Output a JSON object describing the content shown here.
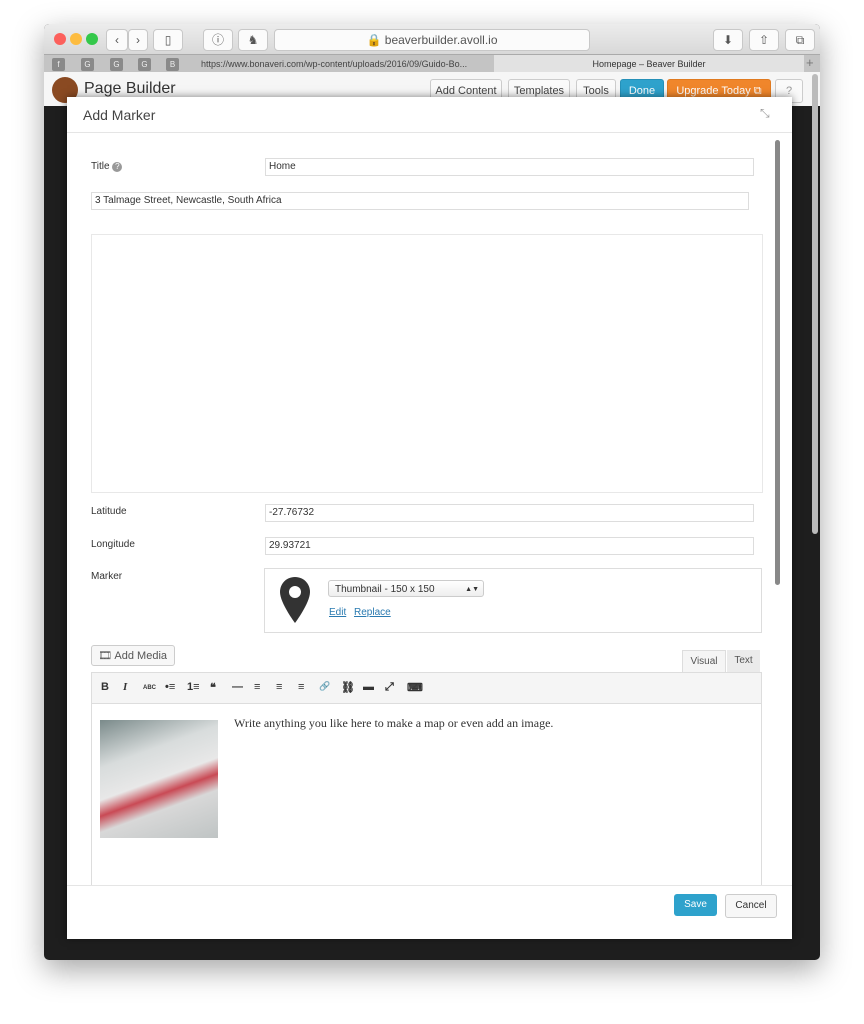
{
  "browser": {
    "url": "beaverbuilder.avoll.io",
    "tabs": [
      {
        "label": "https://www.bonaveri.com/wp-content/uploads/2016/09/Guido-Bo..."
      },
      {
        "label": "Homepage – Beaver Builder"
      }
    ],
    "pinned": [
      "f",
      "G",
      "G",
      "G",
      "B"
    ]
  },
  "builder": {
    "brand": "Page Builder",
    "buttons": [
      "Add Content",
      "Templates",
      "Tools",
      "Done",
      "Upgrade Today"
    ],
    "accent": "#2ea2cc",
    "upgrade_color": "#f0862b"
  },
  "modal": {
    "title": "Add Marker",
    "fields": {
      "title_label": "Title",
      "title_value": "Home",
      "address_value": "3 Talmage Street, Newcastle, South Africa",
      "latitude_label": "Latitude",
      "latitude_value": "-27.76732",
      "longitude_label": "Longitude",
      "longitude_value": "29.93721",
      "marker_label": "Marker",
      "marker_size": "Thumbnail - 150 x 150",
      "edit_link": "Edit",
      "replace_link": "Replace"
    },
    "editor": {
      "add_media": "Add Media",
      "tab_visual": "Visual",
      "tab_text": "Text",
      "toolbar": [
        "B",
        "I",
        "ABC",
        "•≡",
        "1≡",
        "❝",
        "—",
        "≡",
        "≡",
        "≡",
        "🔗",
        "⛓",
        "▬",
        "⤢",
        "⌨"
      ],
      "content": "Write anything you like here to make a map or even add an image."
    },
    "save": "Save",
    "cancel": "Cancel"
  }
}
